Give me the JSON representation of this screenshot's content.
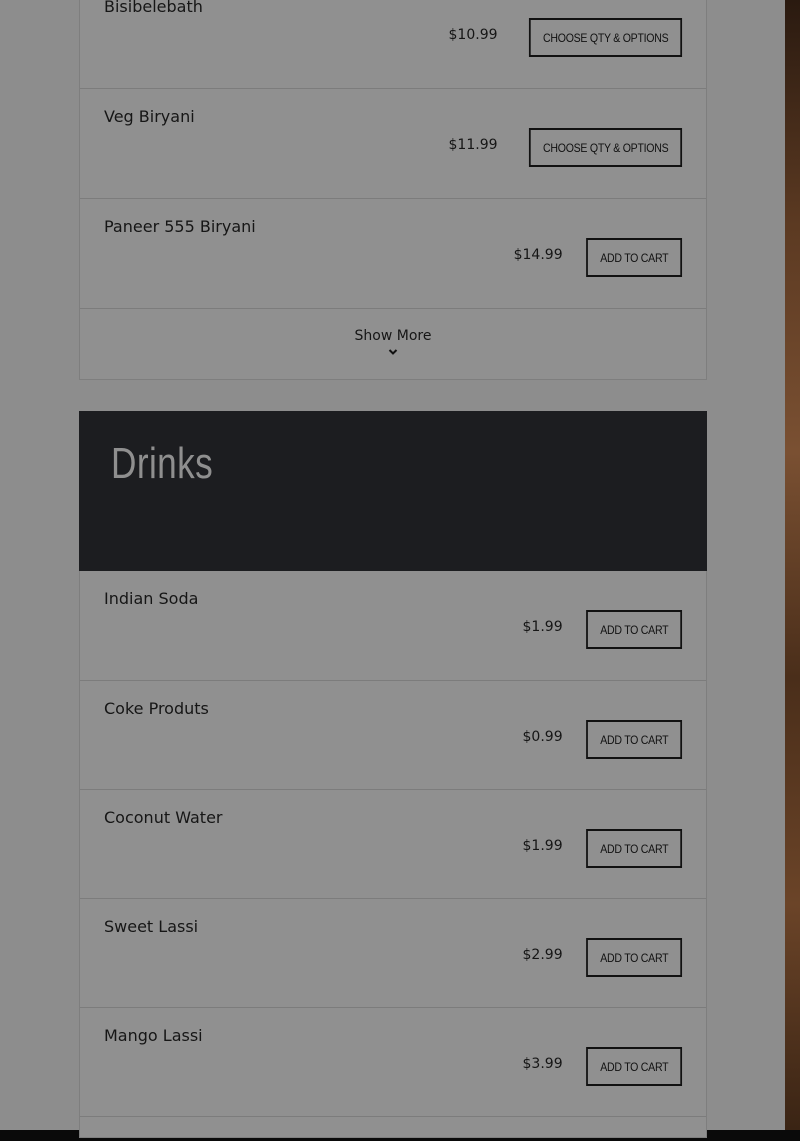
{
  "menu_top": {
    "items": [
      {
        "name": "Bisibelebath",
        "price": "$10.99",
        "button": "Choose Qty & Options"
      },
      {
        "name": "Veg Biryani",
        "price": "$11.99",
        "button": "Choose Qty & Options"
      },
      {
        "name": "Paneer 555 Biryani",
        "price": "$14.99",
        "button": "Add to cart"
      }
    ],
    "show_more": "Show More"
  },
  "drinks": {
    "title": "Drinks",
    "items": [
      {
        "name": "Indian Soda",
        "price": "$1.99",
        "button": "Add to cart"
      },
      {
        "name": "Coke Produts",
        "price": "$0.99",
        "button": "Add to cart"
      },
      {
        "name": "Coconut Water",
        "price": "$1.99",
        "button": "Add to cart"
      },
      {
        "name": "Sweet Lassi",
        "price": "$2.99",
        "button": "Add to cart"
      },
      {
        "name": "Mango Lassi",
        "price": "$3.99",
        "button": "Add to cart"
      }
    ]
  },
  "colors": {
    "overlay_page": "#8d8d8d",
    "header_bg": "#1c1d20",
    "header_text": "#8f8f8f",
    "text": "#161616"
  }
}
